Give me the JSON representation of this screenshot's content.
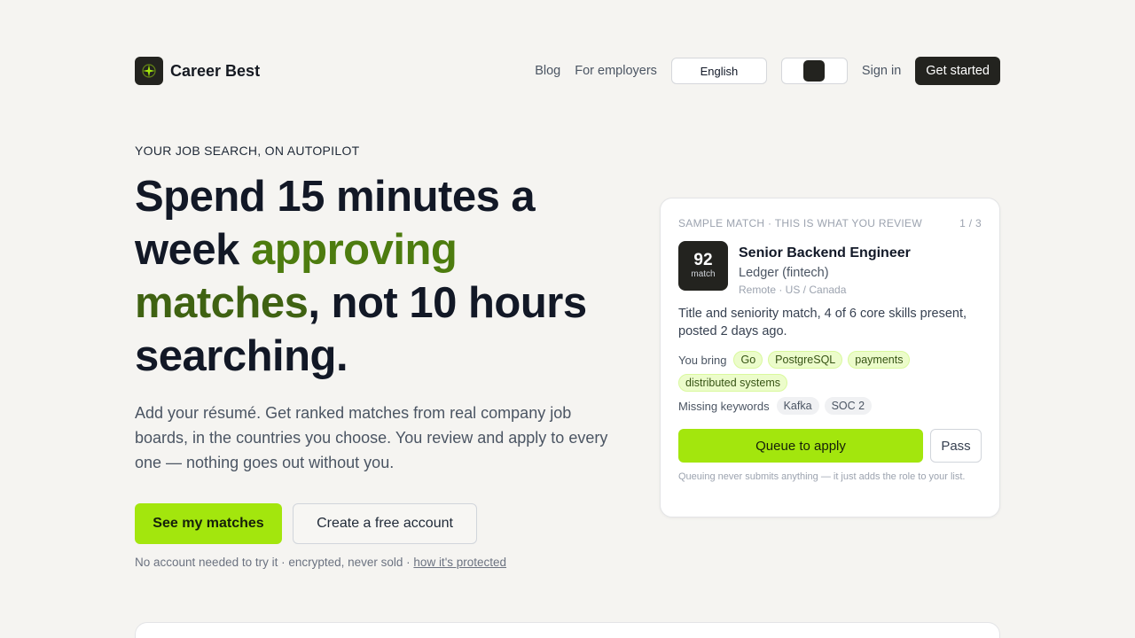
{
  "header": {
    "brand": "Career Best",
    "logo_icon": "compass-star-icon",
    "nav": {
      "blog": "Blog",
      "employers": "For employers",
      "language": "English",
      "sign_in": "Sign in",
      "get_started": "Get started"
    }
  },
  "hero": {
    "eyebrow": "YOUR JOB SEARCH, ON AUTOPILOT",
    "headline": {
      "part1": "Spend 15 minutes a week ",
      "highlight1": "approving",
      "space": " ",
      "highlight2": "matches",
      "part2": ", not 10 hours searching."
    },
    "subcopy": "Add your résumé. Get ranked matches from real company job boards, in the countries you choose. You review and apply to every one — nothing goes out without you.",
    "primary_button": "See my matches",
    "secondary_button": "Create a free account",
    "fineprint": "No account needed to try it · encrypted, never sold · ",
    "fineprint_link": "how it's protected"
  },
  "sample_card": {
    "label": "SAMPLE MATCH · THIS IS WHAT YOU REVIEW",
    "pager": "1 / 3",
    "score": "92",
    "score_label": "match",
    "job_title": "Senior Backend Engineer",
    "company": "Ledger (fintech)",
    "location": "Remote · US / Canada",
    "summary": "Title and seniority match, 4 of 6 core skills present, posted 2 days ago.",
    "you_bring_label": "You bring",
    "you_bring": [
      "Go",
      "PostgreSQL",
      "payments",
      "distributed systems"
    ],
    "missing_label": "Missing keywords",
    "missing": [
      "Kafka",
      "SOC 2"
    ],
    "queue_button": "Queue to apply",
    "pass_button": "Pass",
    "note": "Queuing never submits anything — it just adds the role to your list."
  },
  "colors": {
    "background": "#f5f4f1",
    "accent_lime": "#a3e60d",
    "highlight_green": "#4d7c0f",
    "dark": "#23231f"
  }
}
